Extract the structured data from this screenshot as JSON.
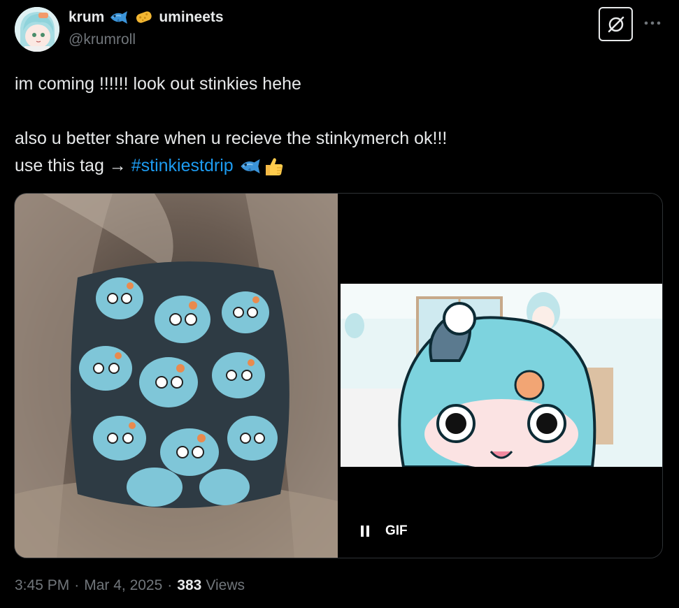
{
  "author": {
    "display_name_1": "krum",
    "display_name_2": "umineets",
    "handle": "@krumroll",
    "name_emojis": [
      "fish-emoji",
      "sponge-emoji"
    ]
  },
  "tweet": {
    "line1": "im coming !!!!!! look out stinkies hehe",
    "line2": "also u better share when u recieve the stinkymerch ok!!!",
    "line3_prefix": "use this tag → ",
    "hashtag": "#stinkiestdrip",
    "trailing_emojis": [
      "fish-emoji",
      "thumbs-up-emoji"
    ]
  },
  "media": {
    "gif_label": "GIF",
    "left_image": "bag-of-plush-toys-photo",
    "right_image": "anime-character-gif"
  },
  "meta": {
    "time": "3:45 PM",
    "separator": "·",
    "date": "Mar 4, 2025",
    "views_count": "383",
    "views_label": "Views"
  },
  "colors": {
    "background": "#000000",
    "text": "#e7e9ea",
    "secondary": "#71767b",
    "link": "#1d9bf0",
    "border": "#2f3336"
  },
  "icons": {
    "grok": "grok-icon",
    "more": "more-icon",
    "pause": "pause-icon"
  }
}
